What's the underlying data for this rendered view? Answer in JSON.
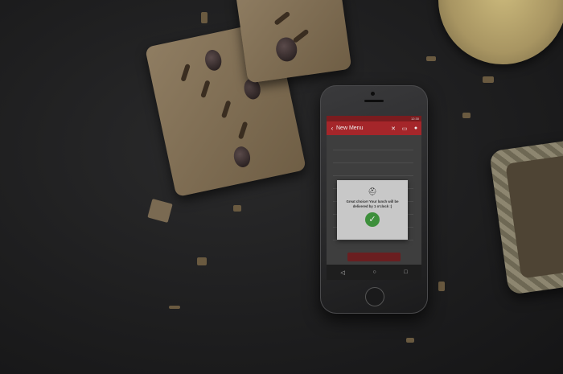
{
  "status": {
    "time": "12:30"
  },
  "appbar": {
    "back_icon": "chevron-left-icon",
    "title": "New Menu",
    "icons": [
      "cutlery-icon",
      "card-icon",
      "person-icon"
    ]
  },
  "dialog": {
    "icon": "food-dish-icon",
    "message": "Great choice! Your lunch will be delivered by 1 o'clock :)"
  },
  "navbar": {
    "back": "◁",
    "home": "○",
    "recent": "□"
  },
  "colors": {
    "appbar": "#a5262a",
    "check": "#3d8f3b"
  }
}
